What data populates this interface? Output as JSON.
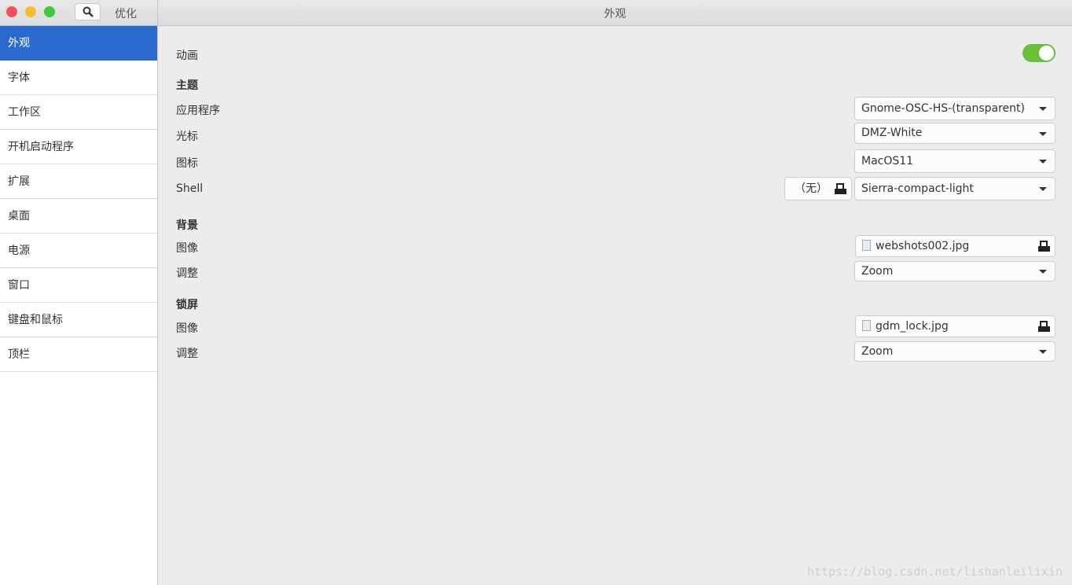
{
  "window": {
    "app_title": "优化",
    "title": "外观",
    "colors": {
      "close": "#f0515a",
      "minimize": "#f6be2f",
      "maximize": "#3fc73e",
      "accent": "#2a6acf",
      "toggle_on": "#6ac03a"
    }
  },
  "sidebar": {
    "items": [
      {
        "label": "外观",
        "active": true
      },
      {
        "label": "字体"
      },
      {
        "label": "工作区"
      },
      {
        "label": "开机启动程序"
      },
      {
        "label": "扩展"
      },
      {
        "label": "桌面"
      },
      {
        "label": "电源"
      },
      {
        "label": "窗口"
      },
      {
        "label": "键盘和鼠标"
      },
      {
        "label": "顶栏"
      }
    ]
  },
  "main": {
    "animation": {
      "label": "动画",
      "enabled": true
    },
    "themes": {
      "header": "主题",
      "app_label": "应用程序",
      "app_value": "Gnome-OSC-HS-(transparent)",
      "cursor_label": "光标",
      "cursor_value": "DMZ-White",
      "icons_label": "图标",
      "icons_value": "MacOS11",
      "shell_label": "Shell",
      "shell_file": "（无）",
      "shell_value": "Sierra-compact-light"
    },
    "background": {
      "header": "背景",
      "image_label": "图像",
      "image_value": "webshots002.jpg",
      "adjust_label": "调整",
      "adjust_value": "Zoom"
    },
    "lockscreen": {
      "header": "锁屏",
      "image_label": "图像",
      "image_value": "gdm_lock.jpg",
      "adjust_label": "调整",
      "adjust_value": "Zoom"
    }
  },
  "watermark": "https://blog.csdn.net/lishanleilixin"
}
